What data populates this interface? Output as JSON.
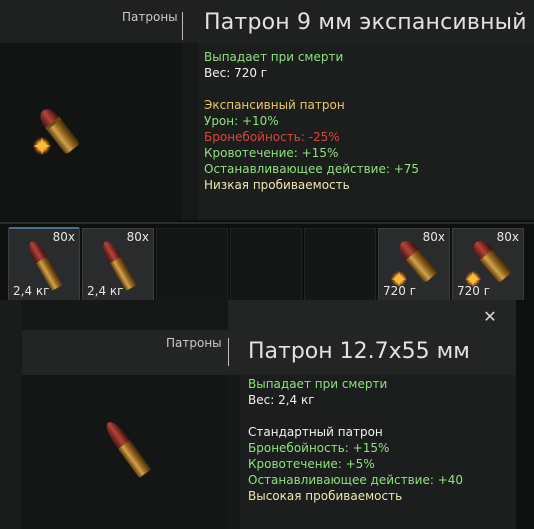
{
  "tooltip_top": {
    "category": "Патроны",
    "title": "Патрон 9 мм экспансивный",
    "lines": [
      {
        "text": "Выпадает при смерти",
        "color": "#8ee37e"
      },
      {
        "text": "Вес: 720 г",
        "color": "#f2f2ee"
      },
      {
        "text": "Экспансивный патрон",
        "color": "#e8c96a"
      },
      {
        "text": "Урон: +10%",
        "color": "#8ee37e"
      },
      {
        "text": "Бронебойность: -25%",
        "color": "#d8483a"
      },
      {
        "text": "Кровотечение: +15%",
        "color": "#8ee37e"
      },
      {
        "text": "Останавливающее действие: +75",
        "color": "#8ee37e"
      },
      {
        "text": "Низкая пробиваемость",
        "color": "#f0e7b0"
      }
    ]
  },
  "inventory": {
    "slots": [
      {
        "count": "80x",
        "weight": "2,4 кг",
        "item": "round-nose-bullet-icon"
      },
      {
        "count": "80x",
        "weight": "2,4 кг",
        "item": "round-nose-bullet-icon"
      },
      {
        "count": "80x",
        "weight": "720 г",
        "item": "expansive-bullet-icon"
      },
      {
        "count": "80x",
        "weight": "720 г",
        "item": "expansive-bullet-icon"
      }
    ]
  },
  "tooltip_bottom": {
    "category": "Патроны",
    "title": "Патрон 12.7х55 мм",
    "close_label": "✕",
    "lines": [
      {
        "text": "Выпадает при смерти",
        "color": "#8ee37e"
      },
      {
        "text": "Вес: 2,4 кг",
        "color": "#f2f2ee"
      },
      {
        "text": "Стандартный патрон",
        "color": "#f2f2ee"
      },
      {
        "text": "Бронебойность: +15%",
        "color": "#8ee37e"
      },
      {
        "text": "Кровотечение: +5%",
        "color": "#8ee37e"
      },
      {
        "text": "Останавливающее действие: +40",
        "color": "#8ee37e"
      },
      {
        "text": "Высокая пробиваемость",
        "color": "#f0e7b0"
      }
    ]
  }
}
